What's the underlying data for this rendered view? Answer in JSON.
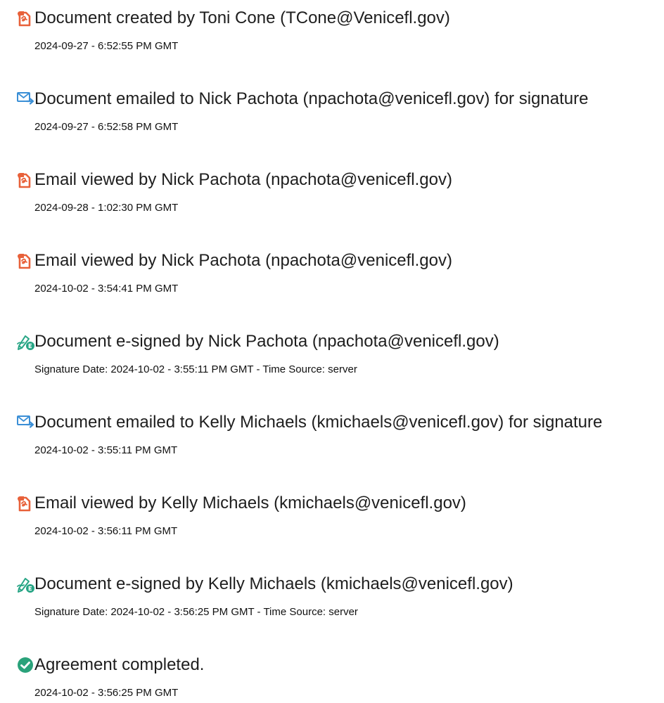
{
  "colors": {
    "document_icon": "#e8613a",
    "email_icon": "#3b8fd6",
    "sign_icon": "#27a585",
    "complete_icon": "#2aa27a"
  },
  "events": [
    {
      "icon": "document-icon",
      "title": "Document created by Toni Cone (TCone@Venicefl.gov)",
      "time": "2024-09-27 - 6:52:55 PM GMT"
    },
    {
      "icon": "email-icon",
      "title": "Document emailed to Nick Pachota (npachota@venicefl.gov) for signature",
      "time": "2024-09-27 - 6:52:58 PM GMT"
    },
    {
      "icon": "document-icon",
      "title": "Email viewed by Nick Pachota (npachota@venicefl.gov)",
      "time": "2024-09-28 - 1:02:30 PM GMT"
    },
    {
      "icon": "document-icon",
      "title": "Email viewed by Nick Pachota (npachota@venicefl.gov)",
      "time": "2024-10-02 - 3:54:41 PM GMT"
    },
    {
      "icon": "sign-icon",
      "title": "Document e-signed by Nick Pachota (npachota@venicefl.gov)",
      "time": "Signature Date: 2024-10-02 - 3:55:11 PM GMT - Time Source: server"
    },
    {
      "icon": "email-icon",
      "title": "Document emailed to Kelly Michaels (kmichaels@venicefl.gov) for signature",
      "time": "2024-10-02 - 3:55:11 PM GMT"
    },
    {
      "icon": "document-icon",
      "title": "Email viewed by Kelly Michaels (kmichaels@venicefl.gov)",
      "time": "2024-10-02 - 3:56:11 PM GMT"
    },
    {
      "icon": "sign-icon",
      "title": "Document e-signed by Kelly Michaels (kmichaels@venicefl.gov)",
      "time": "Signature Date: 2024-10-02 - 3:56:25 PM GMT - Time Source: server"
    },
    {
      "icon": "checkmark-icon",
      "title": "Agreement completed.",
      "time": "2024-10-02 - 3:56:25 PM GMT"
    }
  ]
}
